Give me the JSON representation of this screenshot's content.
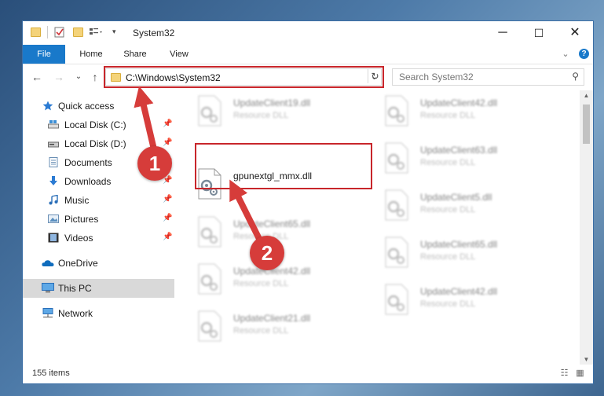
{
  "window": {
    "title": "System32",
    "controls": {
      "minimize": "─",
      "maximize": "☐",
      "close": "✕"
    }
  },
  "ribbon": {
    "tabs": [
      "File",
      "Home",
      "Share",
      "View"
    ],
    "expand": "⌄",
    "help": "?"
  },
  "nav": {
    "back": "←",
    "forward": "→",
    "recent": "⌄",
    "up": "↑",
    "address": "C:\\Windows\\System32",
    "address_dropdown": "⌄",
    "refresh": "↻",
    "search_placeholder": "Search System32",
    "search_icon": "⚲"
  },
  "sidebar": {
    "items": [
      {
        "label": "Quick access",
        "icon": "star-icon",
        "pinned": false
      },
      {
        "label": "Local Disk (C:)",
        "icon": "drive-icon",
        "pinned": true
      },
      {
        "label": "Local Disk (D:)",
        "icon": "drive-icon",
        "pinned": true
      },
      {
        "label": "Documents",
        "icon": "documents-icon",
        "pinned": true
      },
      {
        "label": "Downloads",
        "icon": "downloads-icon",
        "pinned": true
      },
      {
        "label": "Music",
        "icon": "music-icon",
        "pinned": true
      },
      {
        "label": "Pictures",
        "icon": "pictures-icon",
        "pinned": true
      },
      {
        "label": "Videos",
        "icon": "videos-icon",
        "pinned": true
      },
      {
        "label": "OneDrive",
        "icon": "onedrive-icon",
        "pinned": false
      },
      {
        "label": "This PC",
        "icon": "pc-icon",
        "pinned": false,
        "selected": true
      },
      {
        "label": "Network",
        "icon": "network-icon",
        "pinned": false
      }
    ],
    "pin_glyph": "📌"
  },
  "files": {
    "left_column": [
      {
        "name": "UpdateClient19.dll",
        "type": "Resource DLL"
      },
      {
        "name": "gpunextgl_mmx.dll",
        "type": ""
      },
      {
        "name": "UpdateClient65.dll",
        "type": "Resource DLL"
      },
      {
        "name": "UpdateClient42.dll",
        "type": "Resource DLL"
      },
      {
        "name": "UpdateClient21.dll",
        "type": "Resource DLL"
      }
    ],
    "right_column": [
      {
        "name": "UpdateClient42.dll",
        "type": "Resource DLL"
      },
      {
        "name": "UpdateClient63.dll",
        "type": "Resource DLL"
      },
      {
        "name": "UpdateClient5.dll",
        "type": "Resource DLL"
      },
      {
        "name": "UpdateClient65.dll",
        "type": "Resource DLL"
      },
      {
        "name": "UpdateClient42.dll",
        "type": "Resource DLL"
      }
    ]
  },
  "status": {
    "item_count": "155 items"
  },
  "annotations": {
    "step1": "1",
    "step2": "2",
    "color": "#d63c3a"
  },
  "colors": {
    "accent": "#1979ca",
    "highlight_box": "#c8262b"
  }
}
